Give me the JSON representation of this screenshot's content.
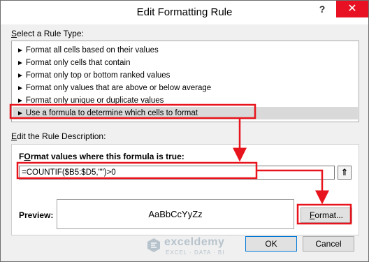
{
  "window": {
    "title": "Edit Formatting Rule",
    "help_glyph": "?",
    "close_glyph": "✕"
  },
  "rule_type": {
    "label_prefix": "",
    "label_u": "S",
    "label_rest": "elect a Rule Type:",
    "items": [
      {
        "label": "Format all cells based on their values"
      },
      {
        "label": "Format only cells that contain"
      },
      {
        "label": "Format only top or bottom ranked values"
      },
      {
        "label": "Format only values that are above or below average"
      },
      {
        "label": "Format only unique or duplicate values"
      },
      {
        "label": "Use a formula to determine which cells to format",
        "selected": true
      }
    ]
  },
  "description": {
    "label_u": "E",
    "label_rest": "dit the Rule Description:",
    "formula_label_u": "O",
    "formula_label_pre": "F",
    "formula_label_rest": "rmat values where this formula is true:",
    "formula_value": "=COUNTIF($B5:$D5,\"\")>0",
    "preview_label": "Preview:",
    "preview_text": "AaBbCcYyZz",
    "format_button_u": "F",
    "format_button_rest": "ormat..."
  },
  "footer": {
    "ok_label": "OK",
    "cancel_label": "Cancel"
  },
  "watermark": {
    "name": "exceldemy",
    "tagline": "EXCEL · DATA · BI"
  },
  "annotation_color": "#e8141d"
}
